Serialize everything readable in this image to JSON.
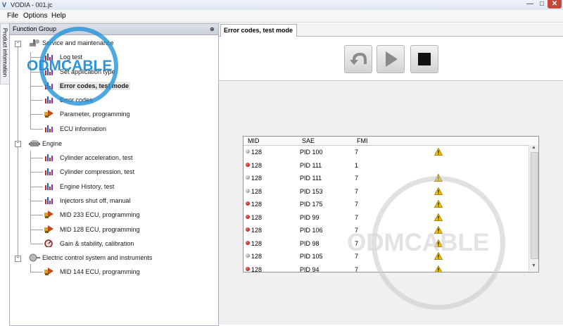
{
  "window": {
    "title": "VODIA - 001.jc",
    "app_icon": "V",
    "controls": {
      "minimize": "—",
      "maximize": "□",
      "close": "✕"
    }
  },
  "menu": [
    "File",
    "Options",
    "Help"
  ],
  "side_tab": {
    "label": "Product information"
  },
  "function_group": {
    "title": "Function Group",
    "pin": "⊕",
    "groups": [
      {
        "label": "Service and maintenance",
        "icon": "wrench-group-icon",
        "items": [
          {
            "label": "Log test",
            "icon": "chart-icon"
          },
          {
            "label": "Set application type",
            "icon": "chart-icon"
          },
          {
            "label": "Error codes, test mode",
            "icon": "chart-icon",
            "selected": true
          },
          {
            "label": "Error codes",
            "icon": "chart-icon"
          },
          {
            "label": "Parameter, programming",
            "icon": "programming-icon"
          },
          {
            "label": "ECU information",
            "icon": "chart-icon"
          }
        ]
      },
      {
        "label": "Engine",
        "icon": "engine-icon",
        "items": [
          {
            "label": "Cylinder acceleration, test",
            "icon": "chart-icon"
          },
          {
            "label": "Cylinder compression, test",
            "icon": "chart-icon"
          },
          {
            "label": "Engine History, test",
            "icon": "chart-icon"
          },
          {
            "label": "Injectors shut off, manual",
            "icon": "chart-icon"
          },
          {
            "label": "MID 233 ECU, programming",
            "icon": "programming-icon"
          },
          {
            "label": "MID 128 ECU, programming",
            "icon": "programming-icon"
          },
          {
            "label": "Gain & stability, calibration",
            "icon": "gauge-icon"
          }
        ]
      },
      {
        "label": "Electric control system and instruments",
        "icon": "electric-icon",
        "items": [
          {
            "label": "MID 144 ECU, programming",
            "icon": "programming-icon"
          }
        ]
      }
    ]
  },
  "main": {
    "tab": "Error codes, test mode",
    "toolbar": {
      "back_icon": "undo-arrow-icon",
      "play_icon": "play-icon",
      "stop_icon": "stop-icon"
    },
    "error_table": {
      "columns": [
        "MID",
        "SAE",
        "FMI"
      ],
      "rows": [
        {
          "status": "gray",
          "mid": "128",
          "sae": "PID 100",
          "fmi": "7",
          "warning": true
        },
        {
          "status": "red",
          "mid": "128",
          "sae": "PID 111",
          "fmi": "1",
          "warning": false
        },
        {
          "status": "gray",
          "mid": "128",
          "sae": "PID 111",
          "fmi": "7",
          "warning": true
        },
        {
          "status": "gray",
          "mid": "128",
          "sae": "PID 153",
          "fmi": "7",
          "warning": true
        },
        {
          "status": "red",
          "mid": "128",
          "sae": "PID 175",
          "fmi": "7",
          "warning": true
        },
        {
          "status": "red",
          "mid": "128",
          "sae": "PID 99",
          "fmi": "7",
          "warning": true
        },
        {
          "status": "red",
          "mid": "128",
          "sae": "PID 106",
          "fmi": "7",
          "warning": true
        },
        {
          "status": "red",
          "mid": "128",
          "sae": "PID 98",
          "fmi": "7",
          "warning": true
        },
        {
          "status": "gray",
          "mid": "128",
          "sae": "PID 105",
          "fmi": "7",
          "warning": true
        },
        {
          "status": "red",
          "mid": "128",
          "sae": "PID 94",
          "fmi": "7",
          "warning": true
        }
      ]
    }
  },
  "watermark": {
    "text": "ODMCABLE"
  },
  "colors": {
    "selected_bg": "#e8e8e8",
    "status_red": "#a40000",
    "status_gray": "#8a8a8a",
    "warning": "#f2c200",
    "watermark_blue": "#1f8fd8"
  }
}
